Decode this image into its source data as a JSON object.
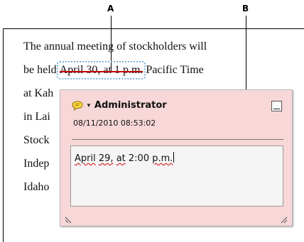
{
  "callouts": {
    "a": "A",
    "b": "B"
  },
  "document": {
    "lines": [
      "The annual meeting of stockholders will",
      "be held",
      "Pacific Time",
      "at Kah",
      "in Lai",
      "Stock",
      "Indep",
      "Idaho"
    ],
    "struck_text": "April 30, at 1 p.m."
  },
  "popup": {
    "author": "Administrator",
    "date": "08/11/2010 08:53:02",
    "comment_words": [
      "April",
      "29,",
      "at",
      "2:00",
      "p.m."
    ]
  },
  "colors": {
    "strike": "#c00000",
    "popup_bg": "#f7d7d7",
    "highlight_border": "#7fb1d8"
  }
}
